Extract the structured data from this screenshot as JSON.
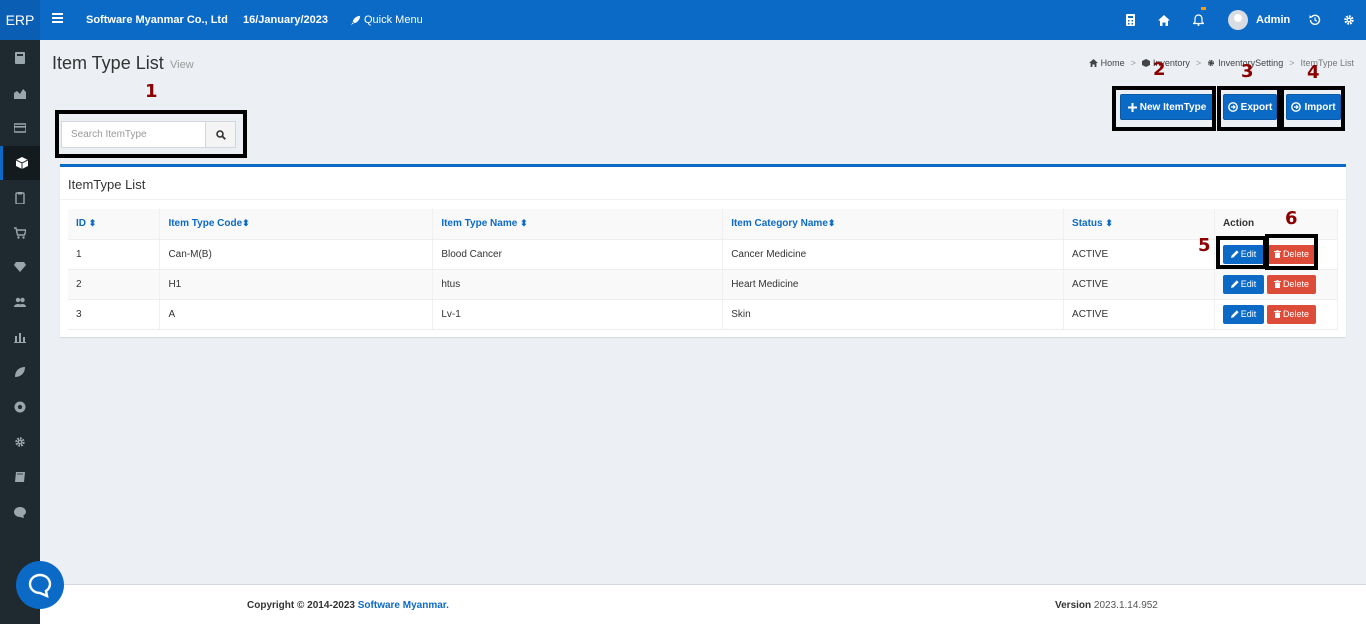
{
  "topbar": {
    "logo": "ERP",
    "company": "Software Myanmar Co., Ltd",
    "date": "16/January/2023",
    "quick_menu": "Quick Menu",
    "user": "Admin"
  },
  "sidebar": {
    "icons": [
      "calculator-icon",
      "chart-area-icon",
      "credit-card-icon",
      "cube-icon",
      "clipboard-icon",
      "shopping-cart-icon",
      "diamond-icon",
      "users-icon",
      "bar-chart-icon",
      "leaf-icon",
      "soccer-ball-icon",
      "gear-icon",
      "book-icon",
      "comment-icon"
    ],
    "active_index": 3
  },
  "page": {
    "title": "Item Type List",
    "subtitle": "View"
  },
  "breadcrumb": {
    "home": "Home",
    "inventory": "Inventory",
    "setting": "InventorySetting",
    "current": "ItemType List"
  },
  "search": {
    "placeholder": "Search ItemType"
  },
  "actions": {
    "new": "New ItemType",
    "export": "Export",
    "import": "Import"
  },
  "annotations": [
    "1",
    "2",
    "3",
    "4",
    "5",
    "6"
  ],
  "card": {
    "title": "ItemType List",
    "columns": [
      "ID",
      "Item Type Code",
      "Item Type Name",
      "Item Category Name",
      "Status",
      "Action"
    ],
    "rows": [
      {
        "id": "1",
        "code": "Can-M(B)",
        "name": "Blood Cancer",
        "category": "Cancer Medicine",
        "status": "ACTIVE"
      },
      {
        "id": "2",
        "code": "H1",
        "name": "htus",
        "category": "Heart Medicine",
        "status": "ACTIVE"
      },
      {
        "id": "3",
        "code": "A",
        "name": "Lv-1",
        "category": "Skin",
        "status": "ACTIVE"
      }
    ],
    "edit_label": "Edit",
    "delete_label": "Delete"
  },
  "footer": {
    "copyright_prefix": "Copyright © 2014-2023",
    "company_link": "Software Myanmar.",
    "version_label": "Version",
    "version": "2023.1.14.952"
  },
  "colors": {
    "primary": "#0c6ac7",
    "danger": "#dd4b39",
    "annotation": "#8b0000",
    "sidebar": "#1f2a30"
  }
}
